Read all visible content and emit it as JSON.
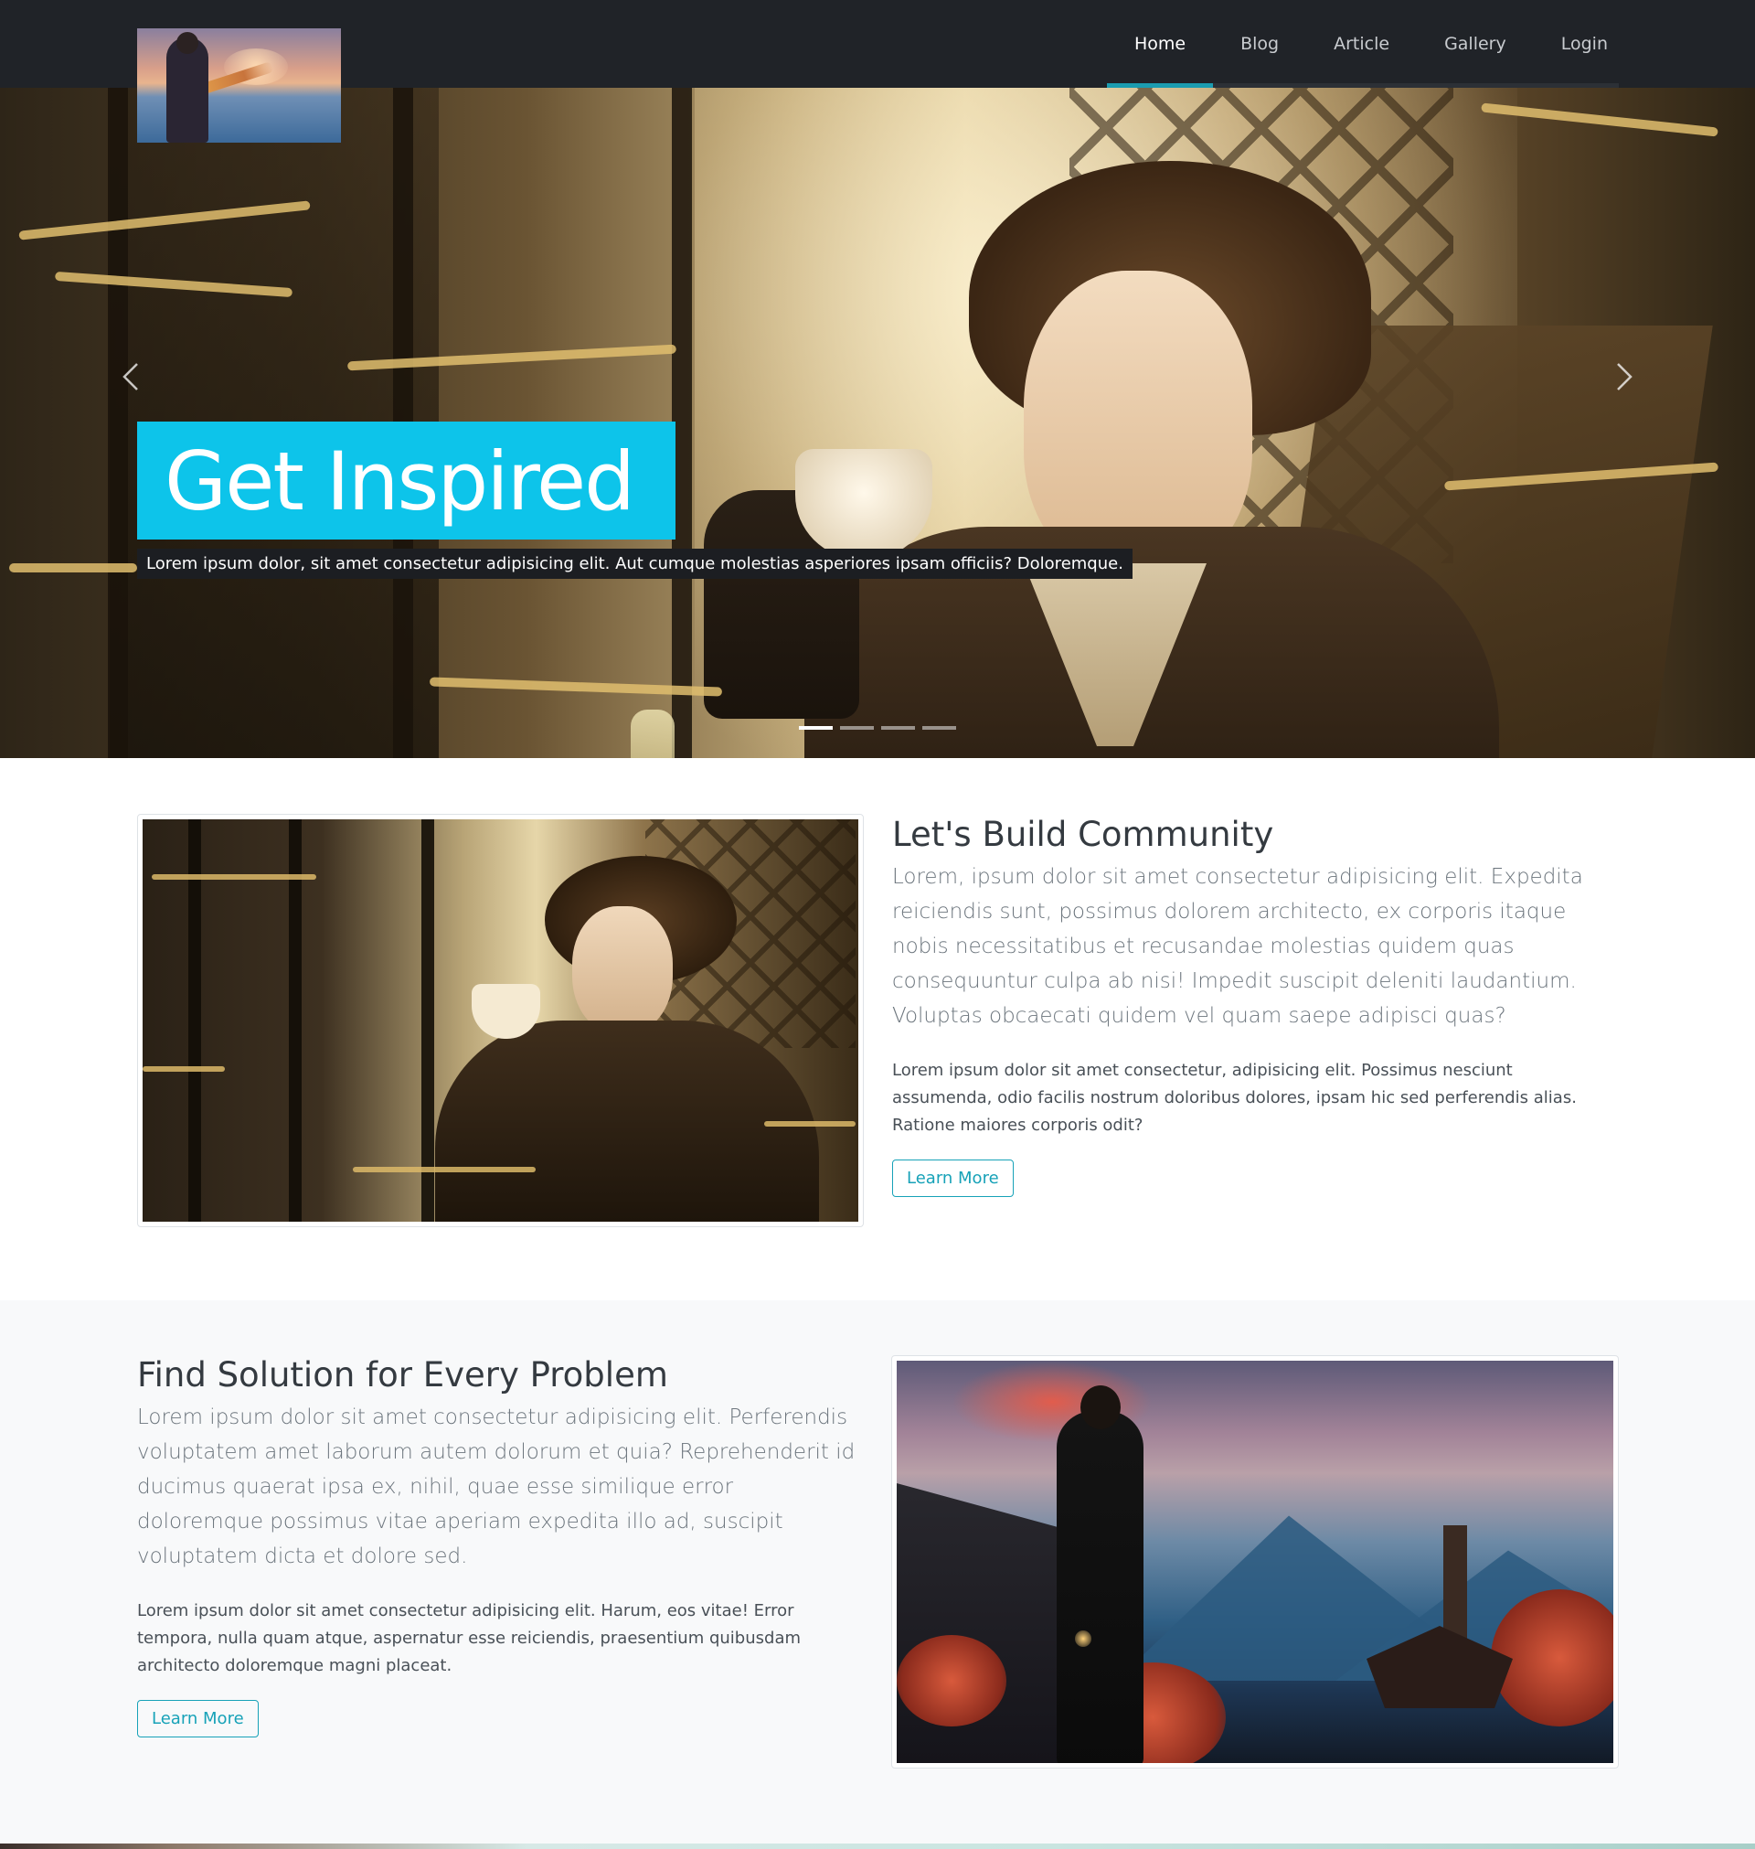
{
  "nav": {
    "logo_alt": "site-logo",
    "items": [
      {
        "label": "Home",
        "active": true
      },
      {
        "label": "Blog",
        "active": false
      },
      {
        "label": "Article",
        "active": false
      },
      {
        "label": "Gallery",
        "active": false
      },
      {
        "label": "Login",
        "active": false
      }
    ]
  },
  "hero": {
    "title": "Get Inspired",
    "subtitle": "Lorem ipsum dolor, sit amet consectetur adipisicing elit. Aut cumque molestias asperiores ipsam officiis? Doloremque.",
    "prev_icon": "chevron-left-icon",
    "next_icon": "chevron-right-icon",
    "slides_count": 4,
    "active_slide": 0
  },
  "section1": {
    "heading": "Let's Build Community",
    "lead": "Lorem, ipsum dolor sit amet consectetur adipisicing elit. Expedita reiciendis sunt, possimus dolorem architecto, ex corporis itaque nobis necessitatibus et recusandae molestias quidem quas consequuntur culpa ab nisi! Impedit suscipit deleniti laudantium. Voluptas obcaecati quidem vel quam saepe adipisci quas?",
    "paragraph": "Lorem ipsum dolor sit amet consectetur, adipisicing elit. Possimus nesciunt assumenda, odio facilis nostrum doloribus dolores, ipsam hic sed perferendis alias. Ratione maiores corporis odit?",
    "button": "Learn More"
  },
  "section2": {
    "heading": "Find Solution for Every Problem",
    "lead": "Lorem ipsum dolor sit amet consectetur adipisicing elit. Perferendis voluptatem amet laborum autem dolorum et quia? Reprehenderit id ducimus quaerat ipsa ex, nihil, quae esse similique error doloremque possimus vitae aperiam expedita illo ad, suscipit voluptatem dicta et dolore sed.",
    "paragraph": "Lorem ipsum dolor sit amet consectetur adipisicing elit. Harum, eos vitae! Error tempora, nulla quam atque, aspernatur esse reiciendis, praesentium quibusdam architecto doloremque magni placeat.",
    "button": "Learn More"
  },
  "colors": {
    "navbar": "#202328",
    "accent": "#0dc4ea",
    "button": "#17a2b8",
    "nav_active_underline": "#1b9cb0"
  }
}
